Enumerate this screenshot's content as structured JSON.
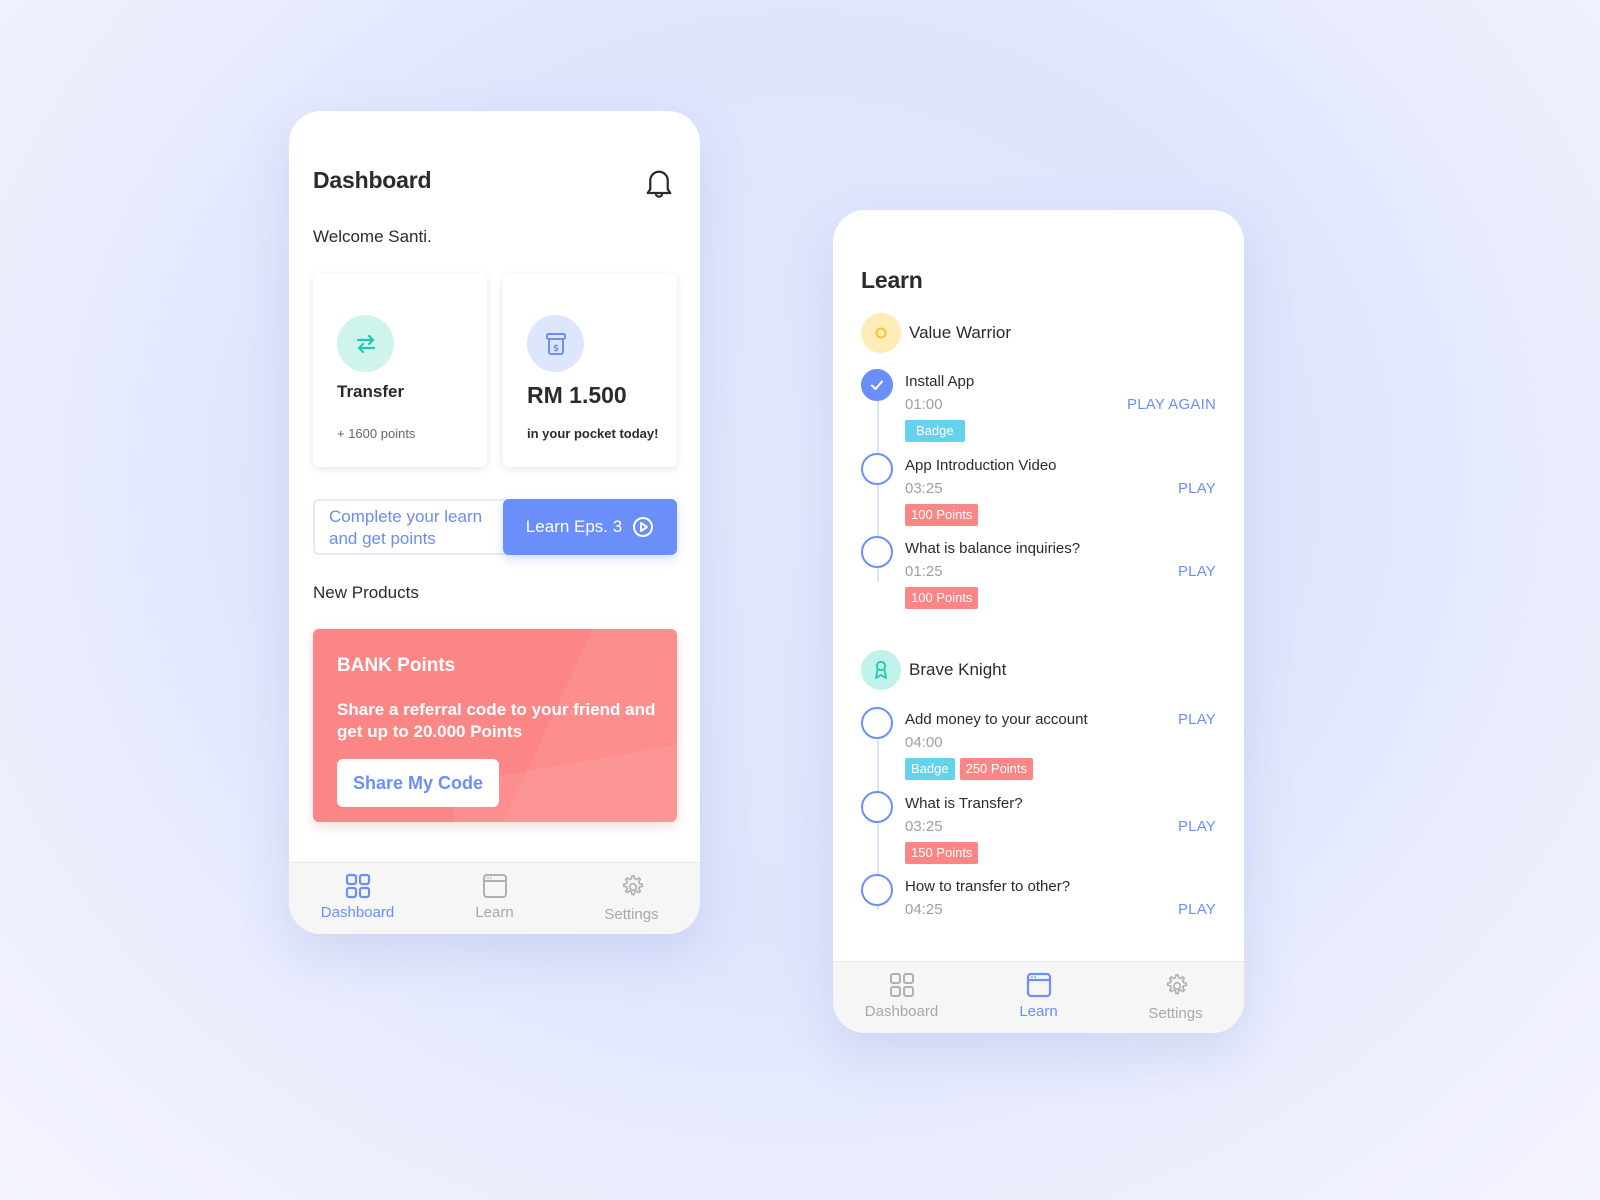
{
  "colors": {
    "accent": "#6a8ffa",
    "coral": "#fc8585",
    "teal": "#1fc9b0",
    "cyan_badge": "#62d3eb",
    "yellow": "#f8c33a"
  },
  "dashboard": {
    "title": "Dashboard",
    "bell_icon": "bell-icon",
    "welcome": "Welcome Santi.",
    "cards": [
      {
        "icon": "transfer-arrows-icon",
        "label": "Transfer",
        "sub": "+ 1600 points"
      },
      {
        "icon": "money-box-icon",
        "amount": "RM 1.500",
        "sub": "in your pocket today!"
      }
    ],
    "promo_text": "Complete your learn and get points",
    "learn_button": "Learn Eps. 3",
    "section_title": "New Products",
    "bank": {
      "title": "BANK Points",
      "description": "Share a referral code to your friend and get up to 20.000 Points",
      "button": "Share My Code"
    }
  },
  "tabs": [
    {
      "label": "Dashboard",
      "icon": "grid-icon"
    },
    {
      "label": "Learn",
      "icon": "window-icon"
    },
    {
      "label": "Settings",
      "icon": "gear-icon"
    }
  ],
  "learn": {
    "title": "Learn",
    "groups": [
      {
        "name": "Value Warrior",
        "icon": "circle-icon",
        "lessons": [
          {
            "title": "Install App",
            "time": "01:00",
            "tags": [
              "Badge"
            ],
            "action": "PLAY AGAIN",
            "done": true
          },
          {
            "title": "App Introduction Video",
            "time": "03:25",
            "tags": [
              "100 Points"
            ],
            "action": "PLAY",
            "done": false
          },
          {
            "title": "What is balance inquiries?",
            "time": "01:25",
            "tags": [
              "100 Points"
            ],
            "action": "PLAY",
            "done": false
          }
        ]
      },
      {
        "name": "Brave Knight",
        "icon": "award-ribbon-icon",
        "lessons": [
          {
            "title": "Add money to your account",
            "time": "04:00",
            "tags": [
              "Badge",
              "250 Points"
            ],
            "action": "PLAY",
            "done": false
          },
          {
            "title": "What is Transfer?",
            "time": "03:25",
            "tags": [
              "150 Points"
            ],
            "action": "PLAY",
            "done": false
          },
          {
            "title": "How to transfer to other?",
            "time": "04:25",
            "tags": [],
            "action": "PLAY",
            "done": false
          }
        ]
      }
    ]
  }
}
